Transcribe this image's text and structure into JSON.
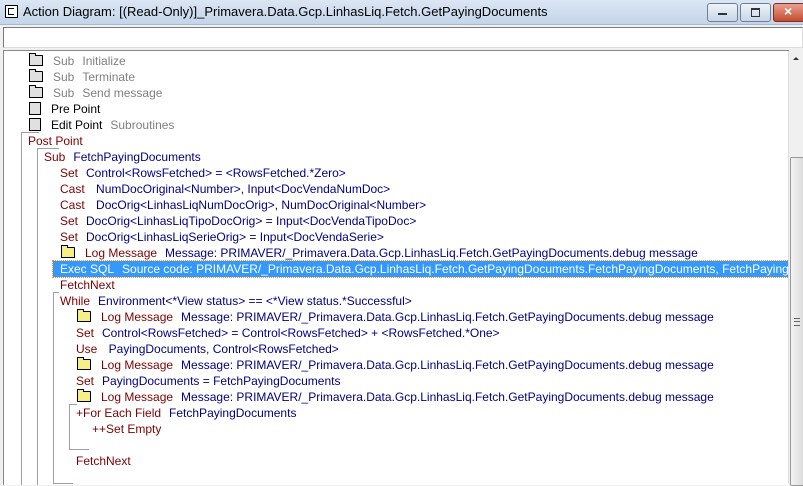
{
  "window": {
    "title": "Action Diagram:  [(Read-Only)]_Primavera.Data.Gcp.LinhasLiq.Fetch.GetPayingDocuments",
    "buttons": [
      "minimize",
      "maximize",
      "close"
    ]
  },
  "command_input": {
    "value": ""
  },
  "colors": {
    "keyword": "#800000",
    "argument": "#000080",
    "inactive": "#808080",
    "selection": "#3399ff"
  },
  "rows": [
    {
      "level": 1,
      "icon": "folder",
      "kw": "Sub",
      "arg": "Initialize",
      "style": "grey"
    },
    {
      "level": 1,
      "icon": "folder",
      "kw": "Sub",
      "arg": "Terminate",
      "style": "grey"
    },
    {
      "level": 1,
      "icon": "folder",
      "kw": "Sub",
      "arg": "Send message",
      "style": "grey"
    },
    {
      "level": 1,
      "icon": "page",
      "kw": "Pre Point",
      "arg": "",
      "style": "black"
    },
    {
      "level": 1,
      "icon": "page",
      "kw": "Edit Point",
      "arg": "Subroutines",
      "style": "black"
    },
    {
      "level": 0,
      "icon": "",
      "kw": "Post Point",
      "arg": "",
      "style": "normal"
    },
    {
      "level": 1,
      "icon": "",
      "kw": "Sub",
      "arg": "FetchPayingDocuments",
      "style": "normal"
    },
    {
      "level": 2,
      "icon": "",
      "kw": "Set",
      "arg": "Control<RowsFetched> = <RowsFetched.*Zero>",
      "style": "normal"
    },
    {
      "level": 2,
      "icon": "",
      "kw": "Cast",
      "arg": " NumDocOriginal<Number>, Input<DocVendaNumDoc>",
      "style": "normal"
    },
    {
      "level": 2,
      "icon": "",
      "kw": "Cast",
      "arg": " DocOrig<LinhasLiqNumDocOrig>, NumDocOriginal<Number>",
      "style": "normal"
    },
    {
      "level": 2,
      "icon": "",
      "kw": "Set",
      "arg": "DocOrig<LinhasLiqTipoDocOrig> = Input<DocVendaTipoDoc>",
      "style": "normal"
    },
    {
      "level": 2,
      "icon": "",
      "kw": "Set",
      "arg": "DocOrig<LinhasLiqSerieOrig> = Input<DocVendaSerie>",
      "style": "normal"
    },
    {
      "level": 2,
      "icon": "folder-yellow",
      "kw": "Log Message",
      "arg": "Message: PRIMAVER/_Primavera.Data.Gcp.LinhasLiq.Fetch.GetPayingDocuments.debug message",
      "style": "normal"
    },
    {
      "level": 2,
      "icon": "",
      "kw": "Exec SQL",
      "arg": "Source code: PRIMAVER/_Primavera.Data.Gcp.LinhasLiq.Fetch.GetPayingDocuments.FetchPayingDocuments, FetchPayingDocuments",
      "style": "normal",
      "selected": true
    },
    {
      "level": 2,
      "icon": "",
      "kw": "FetchNext",
      "arg": "",
      "style": "normal"
    },
    {
      "level": 2,
      "icon": "",
      "kw": "While",
      "arg": "Environment<*View status> == <*View status.*Successful>",
      "style": "normal"
    },
    {
      "level": 3,
      "icon": "folder-yellow",
      "kw": "Log Message",
      "arg": "Message: PRIMAVER/_Primavera.Data.Gcp.LinhasLiq.Fetch.GetPayingDocuments.debug message",
      "style": "normal"
    },
    {
      "level": 3,
      "icon": "",
      "kw": "Set",
      "arg": "Control<RowsFetched> = Control<RowsFetched> + <RowsFetched.*One>",
      "style": "normal"
    },
    {
      "level": 3,
      "icon": "",
      "kw": "Use",
      "arg": " PayingDocuments, Control<RowsFetched>",
      "style": "normal"
    },
    {
      "level": 3,
      "icon": "folder-yellow",
      "kw": "Log Message",
      "arg": "Message: PRIMAVER/_Primavera.Data.Gcp.LinhasLiq.Fetch.GetPayingDocuments.debug message",
      "style": "normal"
    },
    {
      "level": 3,
      "icon": "",
      "kw": "Set",
      "arg": "PayingDocuments = FetchPayingDocuments",
      "style": "normal"
    },
    {
      "level": 3,
      "icon": "folder-yellow",
      "kw": "Log Message",
      "arg": "Message: PRIMAVER/_Primavera.Data.Gcp.LinhasLiq.Fetch.GetPayingDocuments.debug message",
      "style": "normal"
    },
    {
      "level": 3,
      "icon": "",
      "kw": "+For Each Field",
      "arg": "FetchPayingDocuments",
      "style": "normal"
    },
    {
      "level": 4,
      "icon": "",
      "kw": "++Set Empty",
      "arg": "",
      "style": "normal"
    },
    {
      "level": 3,
      "icon": "",
      "kw": "",
      "arg": "",
      "style": "normal"
    },
    {
      "level": 3,
      "icon": "",
      "kw": "FetchNext",
      "arg": "",
      "style": "normal"
    }
  ]
}
